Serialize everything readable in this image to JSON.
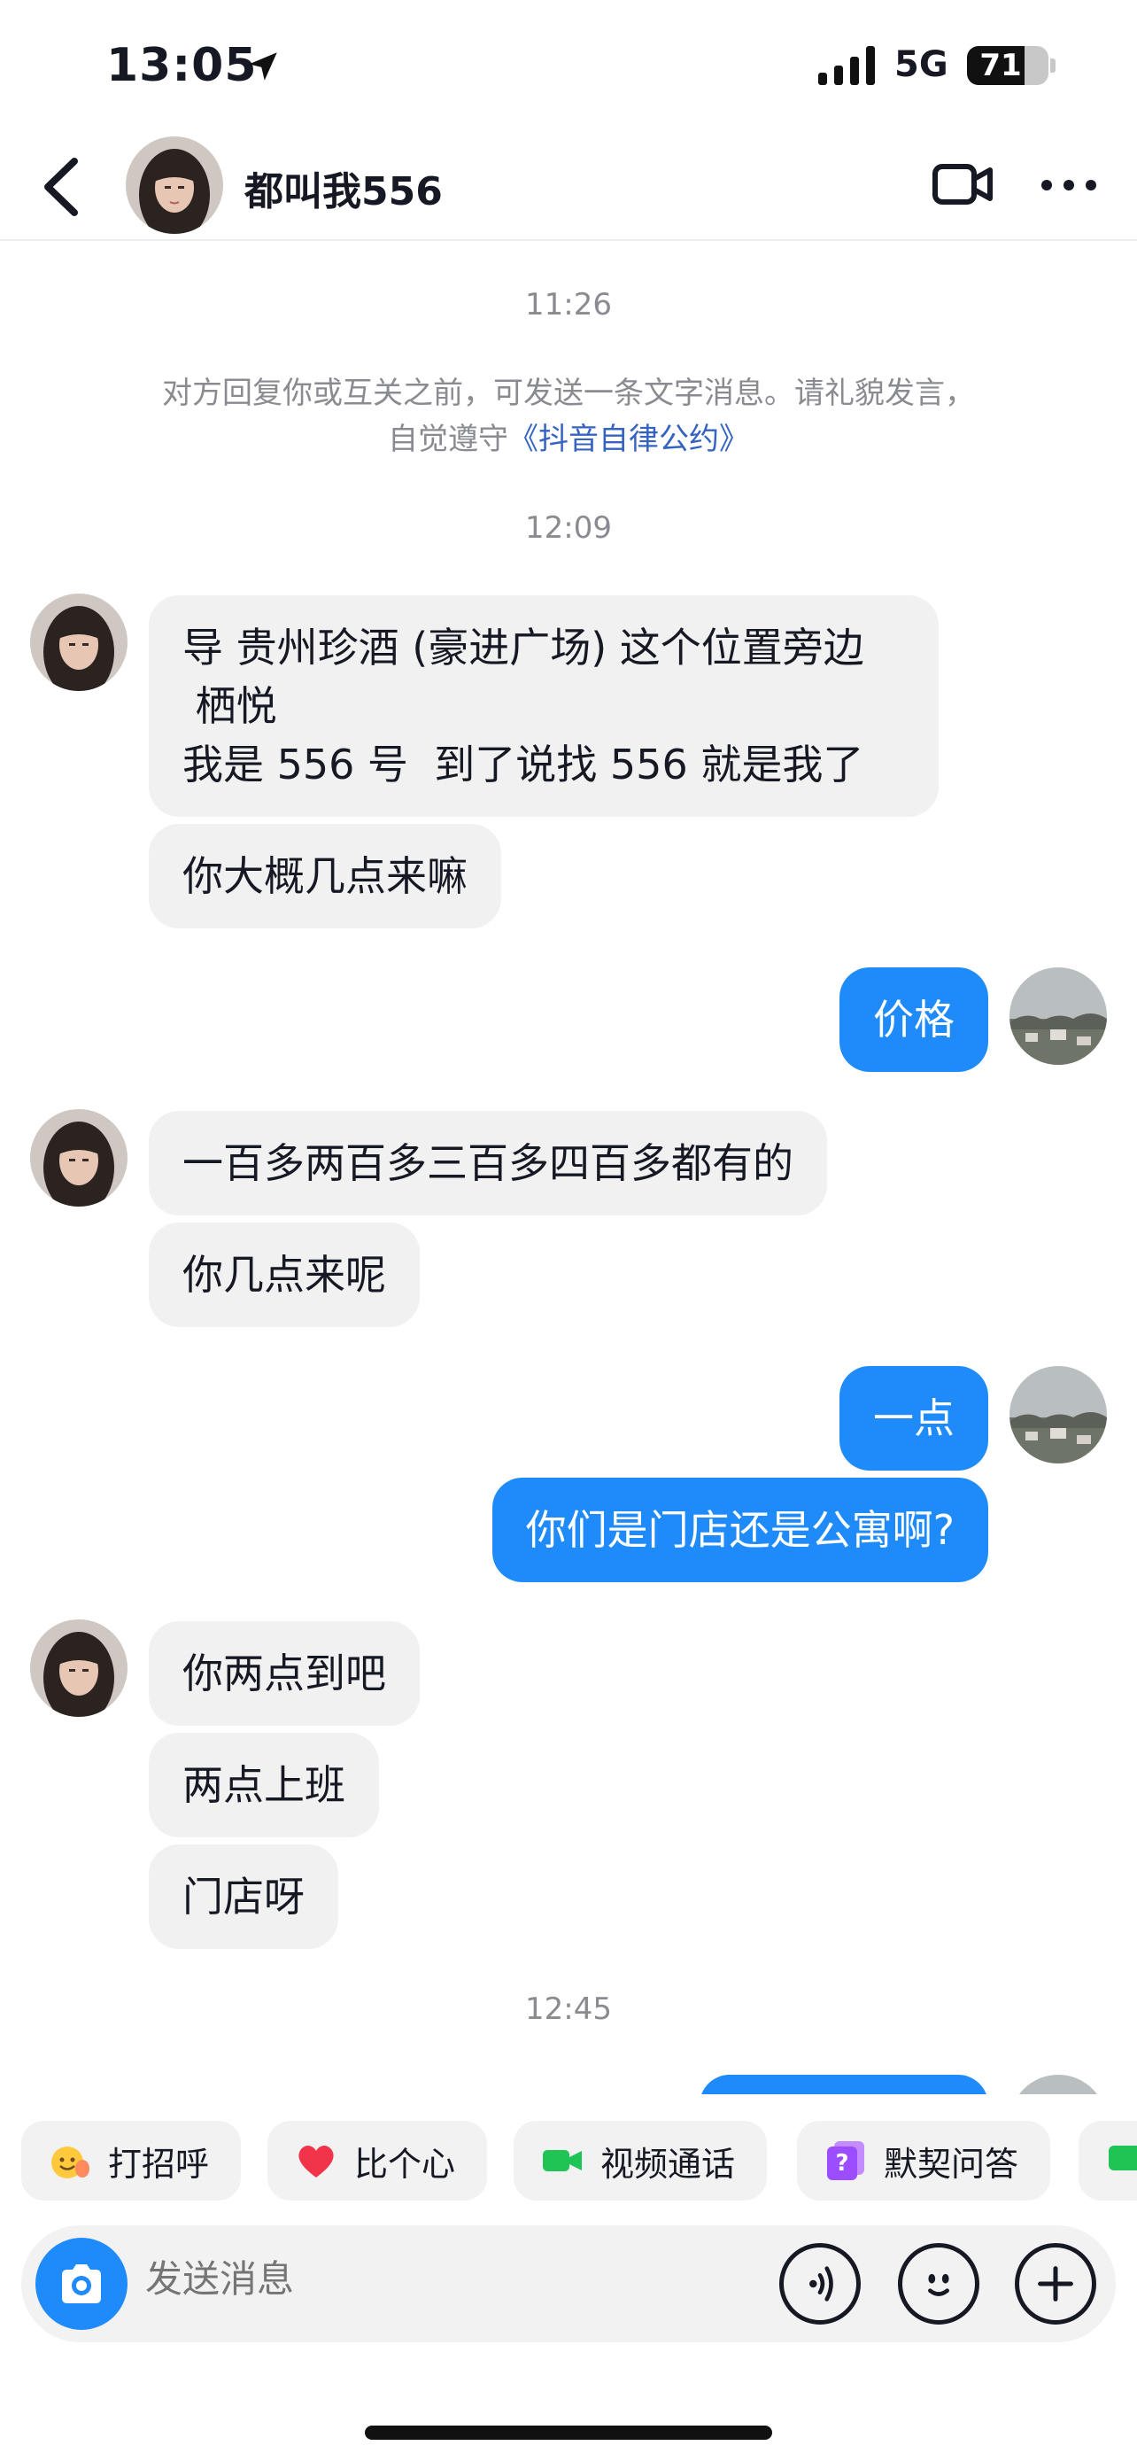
{
  "status_bar": {
    "time": "13:05",
    "network": "5G",
    "battery": "71",
    "battery_level": 0.71
  },
  "header": {
    "name": "都叫我556"
  },
  "chat": {
    "timestamps": [
      "11:26",
      "12:09",
      "12:45"
    ],
    "notice_line1": "对方回复你或互关之前，可发送一条文字消息。请礼貌发言，",
    "notice_prefix": "自觉遵守",
    "notice_link": "《抖音自律公约》",
    "messages": [
      "导 贵州珍酒 (豪进广场) 这个位置旁边\n 栖悦\n我是 556 号  到了说找 556 就是我了",
      "你大概几点来嘛",
      "价格",
      "一百多两百多三百多四百多都有的",
      "你几点来呢",
      "一点",
      "你们是门店还是公寓啊?",
      "你两点到吧",
      "两点上班",
      "门店呀"
    ]
  },
  "quick_actions": [
    "打招呼",
    "比个心",
    "视频通话",
    "默契问答"
  ],
  "input": {
    "placeholder": "发送消息"
  },
  "colors": {
    "outgoing": "#1f8bfb",
    "incoming": "#f1f1f2",
    "link": "#3563c2"
  }
}
